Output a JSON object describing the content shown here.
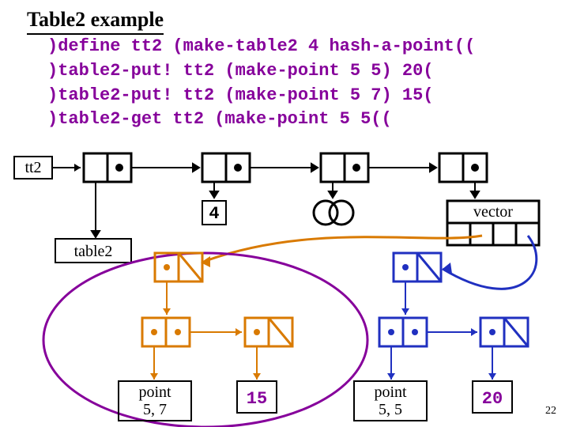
{
  "title": "Table2 example",
  "code": {
    "l1": ")define tt2 (make-table2 4 hash-a-point((",
    "l2": ")table2-put! tt2 (make-point 5 5) 20(",
    "l3": ")table2-put! tt2 (make-point 5 7) 15(",
    "l4": ")table2-get tt2 (make-point 5 5(("
  },
  "labels": {
    "tt2": "tt2",
    "four": "4",
    "vector": "vector",
    "table2": "table2",
    "p57a": "point",
    "p57b": "5, 7",
    "fifteen": "15",
    "p55a": "point",
    "p55b": "5, 5",
    "twenty": "20",
    "pagenum": "22"
  },
  "colors": {
    "purple": "#86009B",
    "orange": "#D97A00",
    "blue": "#2030C0"
  }
}
